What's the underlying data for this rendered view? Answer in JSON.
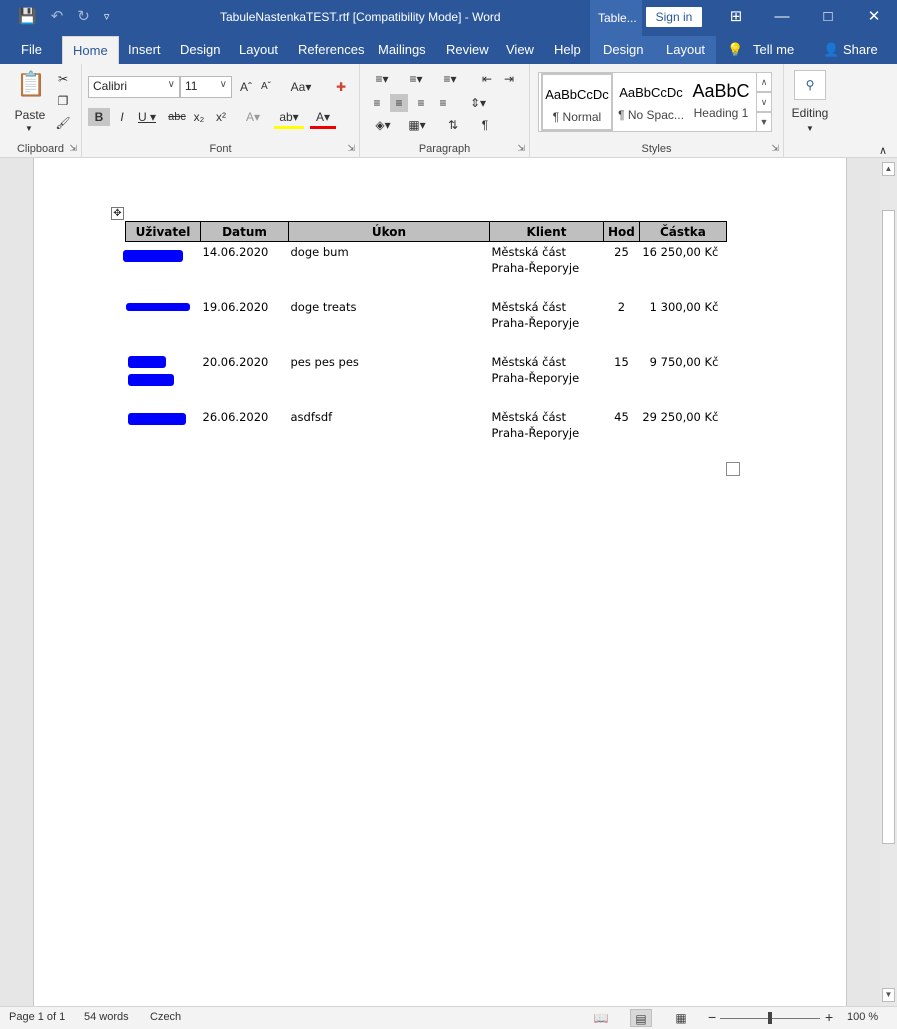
{
  "titlebar": {
    "title": "TabuleNastenkaTEST.rtf [Compatibility Mode]  -  Word",
    "context_tab": "Table...",
    "sign_in": "Sign in"
  },
  "tabs": {
    "file": "File",
    "home": "Home",
    "insert": "Insert",
    "design": "Design",
    "layout": "Layout",
    "references": "References",
    "mailings": "Mailings",
    "review": "Review",
    "view": "View",
    "help": "Help",
    "table_design": "Design",
    "table_layout": "Layout",
    "tell_me": "Tell me",
    "share": "Share"
  },
  "ribbon": {
    "clipboard": {
      "label": "Clipboard",
      "paste": "Paste"
    },
    "font": {
      "label": "Font",
      "family": "Calibri",
      "size": "11"
    },
    "paragraph": {
      "label": "Paragraph"
    },
    "styles": {
      "label": "Styles",
      "items": [
        {
          "preview": "AaBbCcDc",
          "name": "¶ Normal"
        },
        {
          "preview": "AaBbCcDc",
          "name": "¶ No Spac..."
        },
        {
          "preview": "AaBbC",
          "name": "Heading 1"
        }
      ]
    },
    "editing": {
      "label": "Editing"
    }
  },
  "table": {
    "headers": [
      "Uživatel",
      "Datum",
      "Úkon",
      "Klient",
      "Hod",
      "Částka"
    ],
    "rows": [
      {
        "datum": "14.06.2020",
        "ukon": "doge bum",
        "klient1": "Městská část",
        "klient2": "Praha-Řeporyje",
        "hod": "25",
        "castka": "16 250,00 Kč"
      },
      {
        "datum": "19.06.2020",
        "ukon": "doge treats",
        "klient1": "Městská část",
        "klient2": "Praha-Řeporyje",
        "hod": "2",
        "castka": "1 300,00 Kč"
      },
      {
        "datum": "20.06.2020",
        "ukon": "pes pes pes",
        "klient1": "Městská část",
        "klient2": "Praha-Řeporyje",
        "hod": "15",
        "castka": "9 750,00 Kč"
      },
      {
        "datum": "26.06.2020",
        "ukon": "asdfsdf",
        "klient1": "Městská část",
        "klient2": "Praha-Řeporyje",
        "hod": "45",
        "castka": "29 250,00 Kč"
      }
    ]
  },
  "statusbar": {
    "page": "Page 1 of 1",
    "words": "54 words",
    "language": "Czech",
    "zoom": "100 %",
    "zoom_fraction": 0.5
  },
  "colors": {
    "title_blue": "#2b579a",
    "redaction": "#0000ff"
  }
}
